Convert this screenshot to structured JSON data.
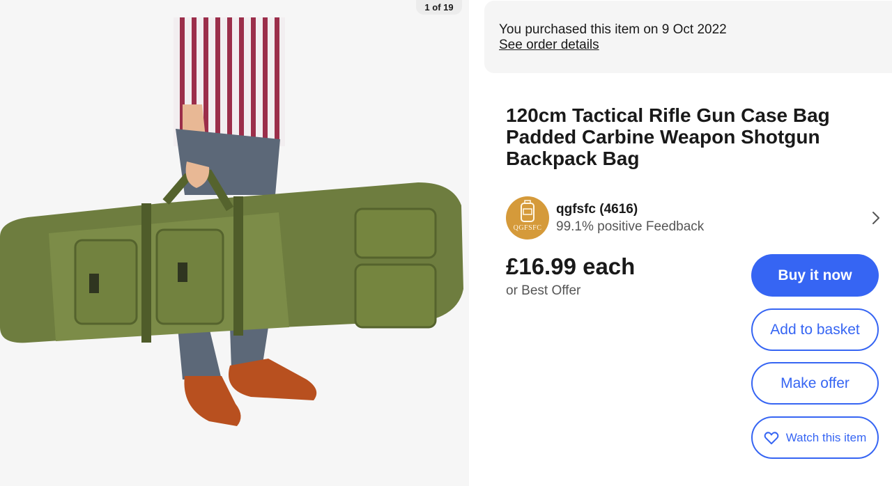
{
  "gallery": {
    "counter": "1 of 19",
    "image_alt": "Man carrying green padded rifle case bag"
  },
  "purchase": {
    "message": "You purchased this item on 9 Oct 2022",
    "order_link": "See order details"
  },
  "listing": {
    "title": "120cm Tactical Rifle Gun Case Bag Padded Carbine Weapon Shotgun Backpack Bag",
    "price": "£16.99 each",
    "best_offer": "or Best Offer"
  },
  "seller": {
    "name": "qgfsfc (4616)",
    "feedback": "99.1% positive Feedback",
    "logo_text": "QGFSFC"
  },
  "actions": {
    "buy_now": "Buy it now",
    "add_to_basket": "Add to basket",
    "make_offer": "Make offer",
    "watch": "Watch this item"
  },
  "colors": {
    "primary": "#3665f3",
    "banner_bg": "#f5f5f5",
    "seller_logo": "#d59a3a"
  },
  "icons": {
    "chevron": "chevron-right-icon",
    "watch": "heart-icon"
  }
}
